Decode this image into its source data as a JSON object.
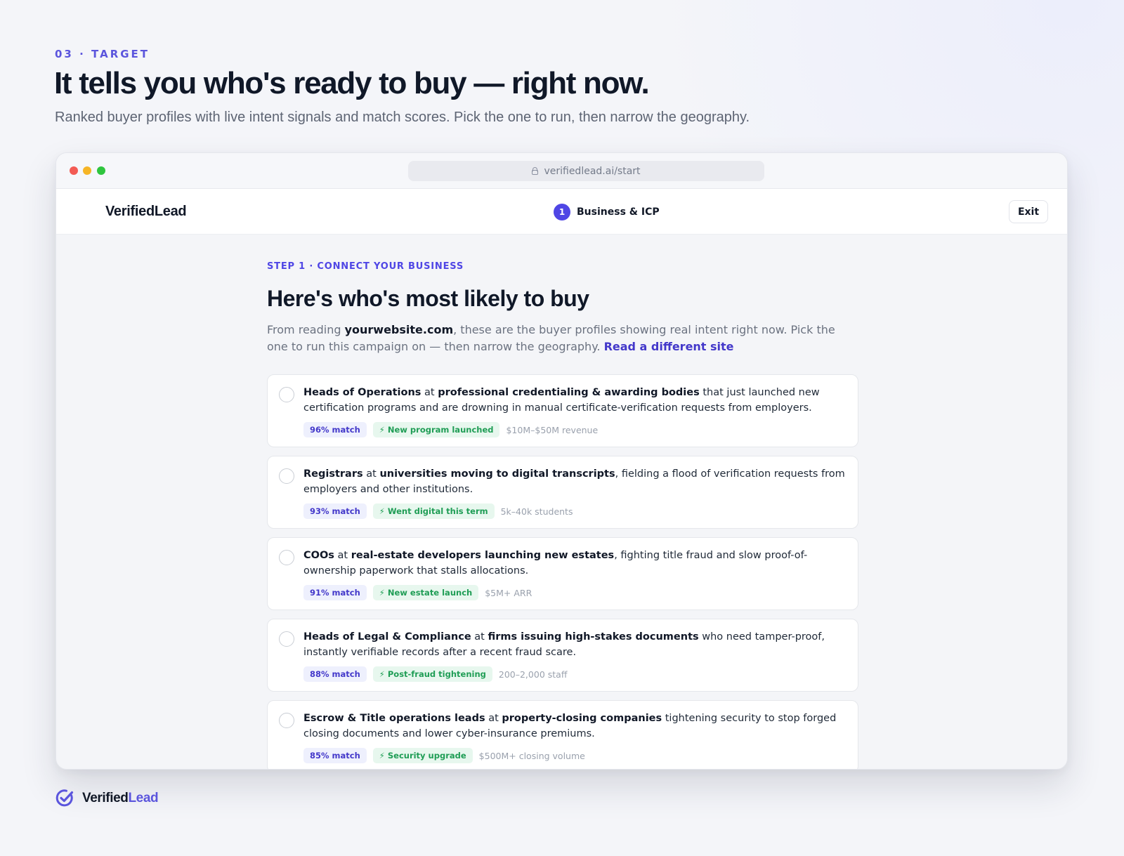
{
  "slide": {
    "eyebrow": "03 · TARGET",
    "headline": "It tells you who's ready to buy — right now.",
    "subhead": "Ranked buyer profiles with live intent signals and match scores. Pick the one to run, then narrow the geography."
  },
  "browser": {
    "url": "verifiedlead.ai/start"
  },
  "app": {
    "brand": "VerifiedLead",
    "step_number": "1",
    "step_label": "Business & ICP",
    "exit_label": "Exit"
  },
  "page": {
    "eyebrow": "STEP 1 · CONNECT YOUR BUSINESS",
    "title": "Here's who's most likely to buy",
    "desc_prefix": "From reading ",
    "desc_site": "yourwebsite.com",
    "desc_suffix": ", these are the buyer profiles showing real intent right now. Pick the one to run this campaign on — then narrow the geography. ",
    "desc_link": "Read a different site"
  },
  "profiles": [
    {
      "role": "Heads of Operations",
      "connector": " at ",
      "segment": "professional credentialing & awarding bodies",
      "detail": " that just launched new certification programs and are drowning in manual certificate-verification requests from employers.",
      "match": "96% match",
      "signal": "⚡ New program launched",
      "meta": "$10M–$50M revenue"
    },
    {
      "role": "Registrars",
      "connector": " at ",
      "segment": "universities moving to digital transcripts",
      "detail": ", fielding a flood of verification requests from employers and other institutions.",
      "match": "93% match",
      "signal": "⚡ Went digital this term",
      "meta": "5k–40k students"
    },
    {
      "role": "COOs",
      "connector": " at ",
      "segment": "real-estate developers launching new estates",
      "detail": ", fighting title fraud and slow proof-of-ownership paperwork that stalls allocations.",
      "match": "91% match",
      "signal": "⚡ New estate launch",
      "meta": "$5M+ ARR"
    },
    {
      "role": "Heads of Legal & Compliance",
      "connector": " at ",
      "segment": "firms issuing high-stakes documents",
      "detail": " who need tamper-proof, instantly verifiable records after a recent fraud scare.",
      "match": "88% match",
      "signal": "⚡ Post-fraud tightening",
      "meta": "200–2,000 staff"
    },
    {
      "role": "Escrow & Title operations leads",
      "connector": " at ",
      "segment": "property-closing companies",
      "detail": " tightening security to stop forged closing documents and lower cyber-insurance premiums.",
      "match": "85% match",
      "signal": "⚡ Security upgrade",
      "meta": "$500M+ closing volume"
    }
  ],
  "footer": {
    "brand_main": "Verified",
    "brand_accent": "Lead"
  },
  "colors": {
    "accent": "#4f46e5",
    "signal_green": "#1f9d55",
    "text_dark": "#101828"
  }
}
